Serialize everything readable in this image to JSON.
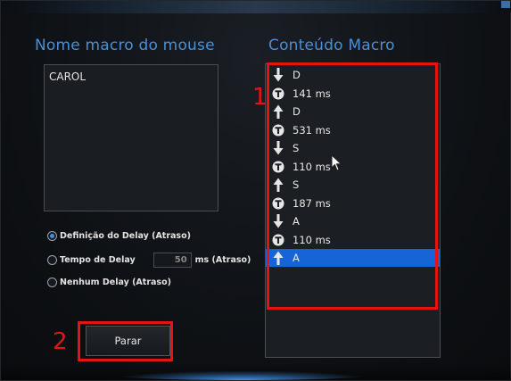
{
  "left_panel": {
    "title": "Nome macro do mouse",
    "macro_name": "CAROL"
  },
  "right_panel": {
    "title": "Conteúdo Macro",
    "entries": [
      {
        "icon": "arrow-down-icon",
        "text": "D"
      },
      {
        "icon": "timer-icon",
        "text": "141 ms"
      },
      {
        "icon": "arrow-up-icon",
        "text": "D"
      },
      {
        "icon": "timer-icon",
        "text": "531 ms"
      },
      {
        "icon": "arrow-down-icon",
        "text": "S"
      },
      {
        "icon": "timer-icon",
        "text": "110 ms"
      },
      {
        "icon": "arrow-up-icon",
        "text": "S"
      },
      {
        "icon": "timer-icon",
        "text": "187 ms"
      },
      {
        "icon": "arrow-down-icon",
        "text": "A"
      },
      {
        "icon": "timer-icon",
        "text": "110 ms"
      },
      {
        "icon": "arrow-up-icon",
        "text": "A",
        "selected": true
      }
    ]
  },
  "delay": {
    "option_define": "Definição do Delay (Atraso)",
    "option_time": "Tempo de Delay",
    "time_value": "50",
    "time_unit": "ms (Atraso)",
    "option_none": "Nenhum Delay (Atraso)",
    "selected": "option_define"
  },
  "stop_button_label": "Parar",
  "annotations": {
    "label_1": "1",
    "label_2": "2",
    "color": "#e51414"
  },
  "colors": {
    "accent": "#4a8ed8",
    "selection": "#1565d8"
  }
}
